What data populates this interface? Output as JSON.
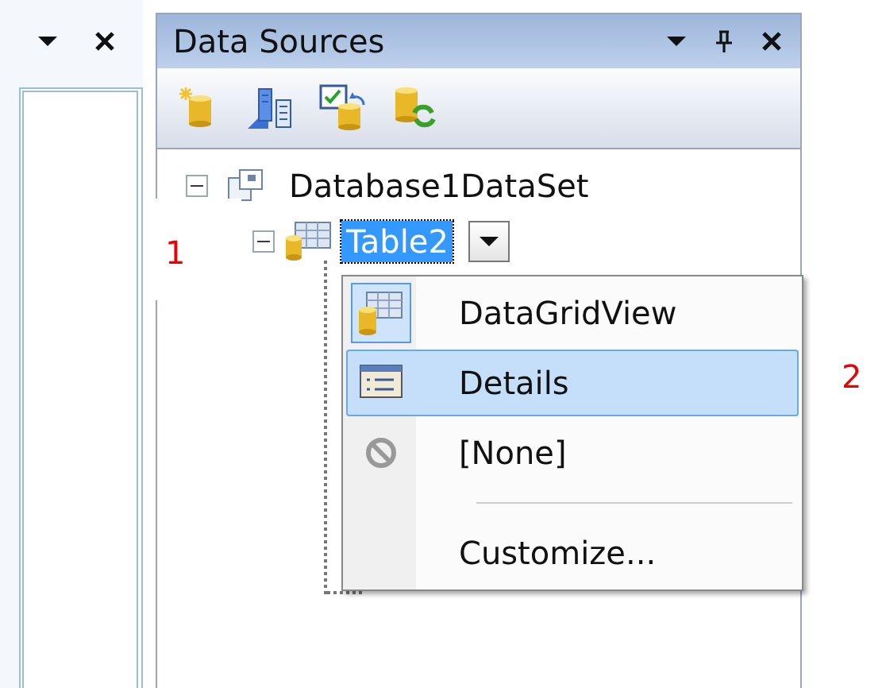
{
  "panel": {
    "title": "Data Sources"
  },
  "tree": [
    {
      "label": "Database1DataSet",
      "kind": "dataset",
      "expanded": true,
      "children": [
        {
          "label": "Table2",
          "kind": "table",
          "selected": true,
          "expanded": true
        }
      ]
    }
  ],
  "dropdown_menu": {
    "items": [
      {
        "kind": "item",
        "label": "DataGridView",
        "checked": true,
        "selected": false
      },
      {
        "kind": "item",
        "label": "Details",
        "checked": false,
        "selected": true
      },
      {
        "kind": "item",
        "label": "[None]",
        "checked": false,
        "selected": false
      },
      {
        "kind": "separator"
      },
      {
        "kind": "item",
        "label": "Customize...",
        "checked": false,
        "selected": false
      }
    ]
  },
  "annotations": [
    {
      "label": "1"
    },
    {
      "label": "2"
    }
  ]
}
